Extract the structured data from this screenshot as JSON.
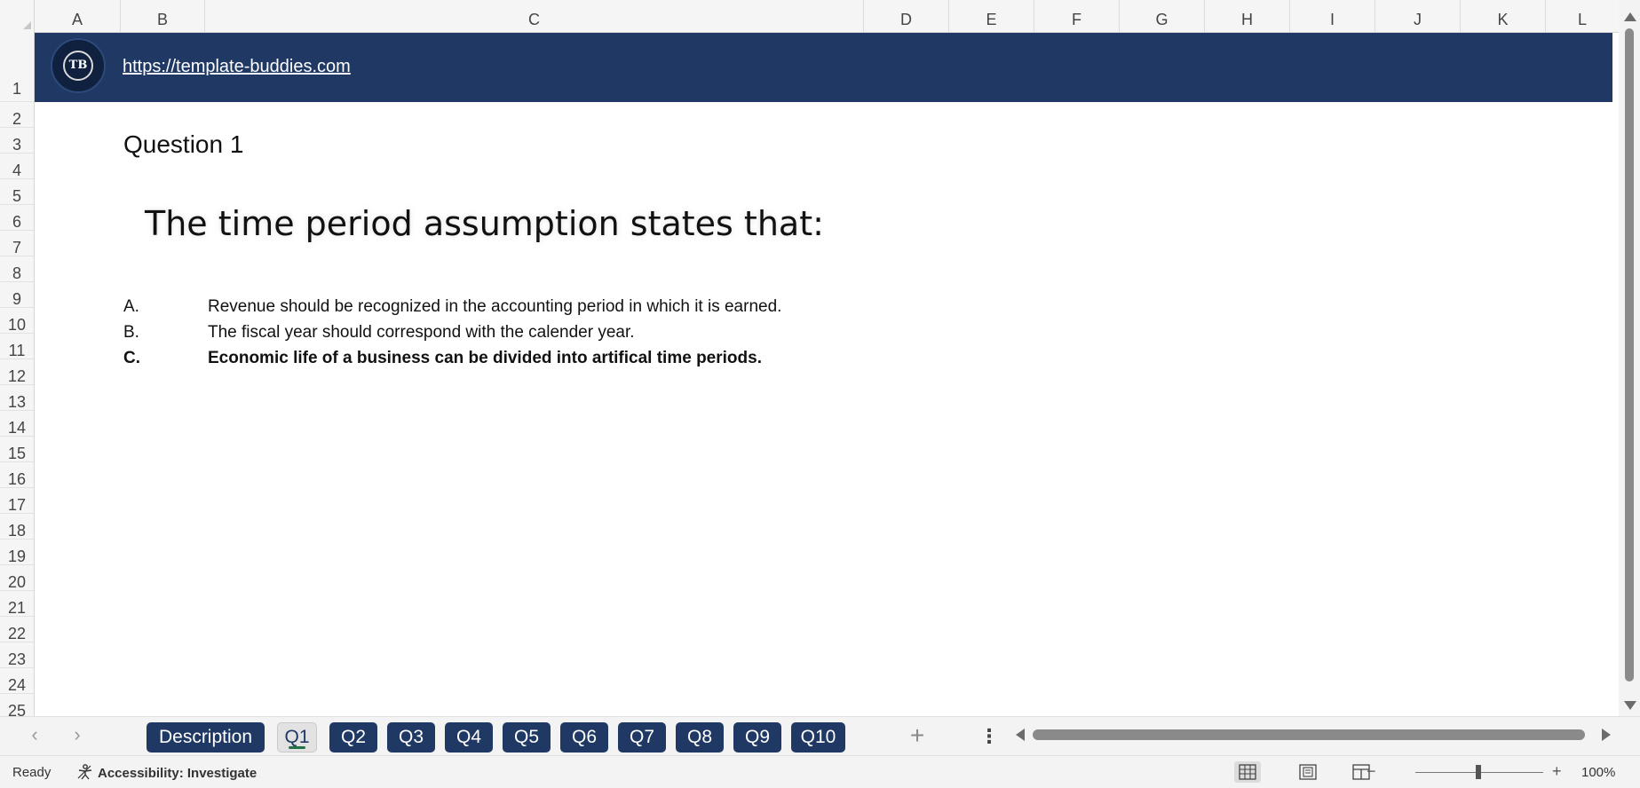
{
  "columns": [
    "A",
    "B",
    "C",
    "D",
    "E",
    "F",
    "G",
    "H",
    "I",
    "J",
    "K",
    "L"
  ],
  "rows": [
    "1",
    "2",
    "3",
    "4",
    "5",
    "6",
    "7",
    "8",
    "9",
    "10",
    "11",
    "12",
    "13",
    "14",
    "15",
    "16",
    "17",
    "18",
    "19",
    "20",
    "21",
    "22",
    "23",
    "24",
    "25"
  ],
  "banner": {
    "logo_text": "TB",
    "link": "https://template-buddies.com",
    "color": "#1f3864"
  },
  "question": {
    "heading": "Question 1",
    "text": "The time period assumption states that:",
    "answers": [
      {
        "letter": "A.",
        "text": "Revenue should be recognized in the accounting period in which it is earned.",
        "bold": false
      },
      {
        "letter": "B.",
        "text": "The fiscal year should correspond with the calender year.",
        "bold": false
      },
      {
        "letter": "C.",
        "text": "Economic life of a business can be divided into artifical time periods.",
        "bold": true
      }
    ]
  },
  "tabs": [
    "Description",
    "Q1",
    "Q2",
    "Q3",
    "Q4",
    "Q5",
    "Q6",
    "Q7",
    "Q8",
    "Q9",
    "Q10"
  ],
  "active_tab": "Q1",
  "status": {
    "ready": "Ready",
    "accessibility": "Accessibility: Investigate",
    "zoom": "100%"
  },
  "icons": {
    "prev_sheet": "chevron-left-icon",
    "next_sheet": "chevron-right-icon",
    "add_sheet": "plus-icon",
    "more": "more-vertical-icon",
    "zoom_minus": "minus-icon",
    "zoom_plus": "plus-icon"
  },
  "colors": {
    "accent": "#217346",
    "tab_bg": "#1f3864"
  }
}
